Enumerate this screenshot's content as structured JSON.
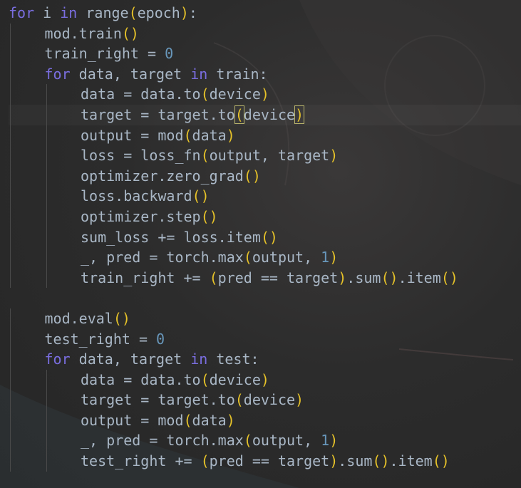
{
  "lines": [
    {
      "indent": 0,
      "tokens": [
        [
          "kw",
          "for"
        ],
        [
          "t",
          " i "
        ],
        [
          "kw",
          "in"
        ],
        [
          "t",
          " range"
        ],
        [
          "br",
          "("
        ],
        [
          "t",
          "epoch"
        ],
        [
          "br",
          ")"
        ],
        [
          "t",
          ":"
        ]
      ]
    },
    {
      "indent": 1,
      "tokens": [
        [
          "t",
          "mod.train"
        ],
        [
          "br",
          "()"
        ]
      ]
    },
    {
      "indent": 1,
      "tokens": [
        [
          "t",
          "train_right = "
        ],
        [
          "num",
          "0"
        ]
      ]
    },
    {
      "indent": 1,
      "tokens": [
        [
          "kw",
          "for"
        ],
        [
          "t",
          " data, target "
        ],
        [
          "kw",
          "in"
        ],
        [
          "t",
          " train:"
        ]
      ]
    },
    {
      "indent": 2,
      "tokens": [
        [
          "t",
          "data = data.to"
        ],
        [
          "br",
          "("
        ],
        [
          "t",
          "device"
        ],
        [
          "br",
          ")"
        ]
      ]
    },
    {
      "indent": 2,
      "tokens": [
        [
          "t",
          "target = target.to"
        ],
        [
          "brm",
          "("
        ],
        [
          "t",
          "device"
        ],
        [
          "brm",
          ")"
        ]
      ]
    },
    {
      "indent": 2,
      "tokens": [
        [
          "t",
          "output = mod"
        ],
        [
          "br",
          "("
        ],
        [
          "t",
          "data"
        ],
        [
          "br",
          ")"
        ]
      ]
    },
    {
      "indent": 2,
      "tokens": [
        [
          "t",
          "loss = loss_fn"
        ],
        [
          "br",
          "("
        ],
        [
          "t",
          "output, target"
        ],
        [
          "br",
          ")"
        ]
      ]
    },
    {
      "indent": 2,
      "tokens": [
        [
          "t",
          "optimizer.zero_grad"
        ],
        [
          "br",
          "()"
        ]
      ]
    },
    {
      "indent": 2,
      "tokens": [
        [
          "t",
          "loss.backward"
        ],
        [
          "br",
          "()"
        ]
      ]
    },
    {
      "indent": 2,
      "tokens": [
        [
          "t",
          "optimizer.step"
        ],
        [
          "br",
          "()"
        ]
      ]
    },
    {
      "indent": 2,
      "tokens": [
        [
          "t",
          "sum_loss += loss.item"
        ],
        [
          "br",
          "()"
        ]
      ]
    },
    {
      "indent": 2,
      "tokens": [
        [
          "t",
          "_, pred = torch.max"
        ],
        [
          "br",
          "("
        ],
        [
          "t",
          "output, "
        ],
        [
          "num",
          "1"
        ],
        [
          "br",
          ")"
        ]
      ]
    },
    {
      "indent": 2,
      "tokens": [
        [
          "t",
          "train_right += "
        ],
        [
          "br",
          "("
        ],
        [
          "t",
          "pred == target"
        ],
        [
          "br",
          ")"
        ],
        [
          "t",
          ".sum"
        ],
        [
          "br",
          "()"
        ],
        [
          "t",
          ".item"
        ],
        [
          "br",
          "()"
        ]
      ]
    },
    {
      "indent": 0,
      "tokens": []
    },
    {
      "indent": 1,
      "tokens": [
        [
          "t",
          "mod.eval"
        ],
        [
          "br",
          "()"
        ]
      ]
    },
    {
      "indent": 1,
      "tokens": [
        [
          "t",
          "test_right = "
        ],
        [
          "num",
          "0"
        ]
      ]
    },
    {
      "indent": 1,
      "tokens": [
        [
          "kw",
          "for"
        ],
        [
          "t",
          " data, target "
        ],
        [
          "kw",
          "in"
        ],
        [
          "t",
          " test:"
        ]
      ]
    },
    {
      "indent": 2,
      "tokens": [
        [
          "t",
          "data = data.to"
        ],
        [
          "br",
          "("
        ],
        [
          "t",
          "device"
        ],
        [
          "br",
          ")"
        ]
      ]
    },
    {
      "indent": 2,
      "tokens": [
        [
          "t",
          "target = target.to"
        ],
        [
          "br",
          "("
        ],
        [
          "t",
          "device"
        ],
        [
          "br",
          ")"
        ]
      ]
    },
    {
      "indent": 2,
      "tokens": [
        [
          "t",
          "output = mod"
        ],
        [
          "br",
          "("
        ],
        [
          "t",
          "data"
        ],
        [
          "br",
          ")"
        ]
      ]
    },
    {
      "indent": 2,
      "tokens": [
        [
          "t",
          "_, pred = torch.max"
        ],
        [
          "br",
          "("
        ],
        [
          "t",
          "output, "
        ],
        [
          "num",
          "1"
        ],
        [
          "br",
          ")"
        ]
      ]
    },
    {
      "indent": 2,
      "tokens": [
        [
          "t",
          "test_right += "
        ],
        [
          "br",
          "("
        ],
        [
          "t",
          "pred == target"
        ],
        [
          "br",
          ")"
        ],
        [
          "t",
          ".sum"
        ],
        [
          "br",
          "()"
        ],
        [
          "t",
          ".item"
        ],
        [
          "br",
          "()"
        ]
      ]
    }
  ]
}
